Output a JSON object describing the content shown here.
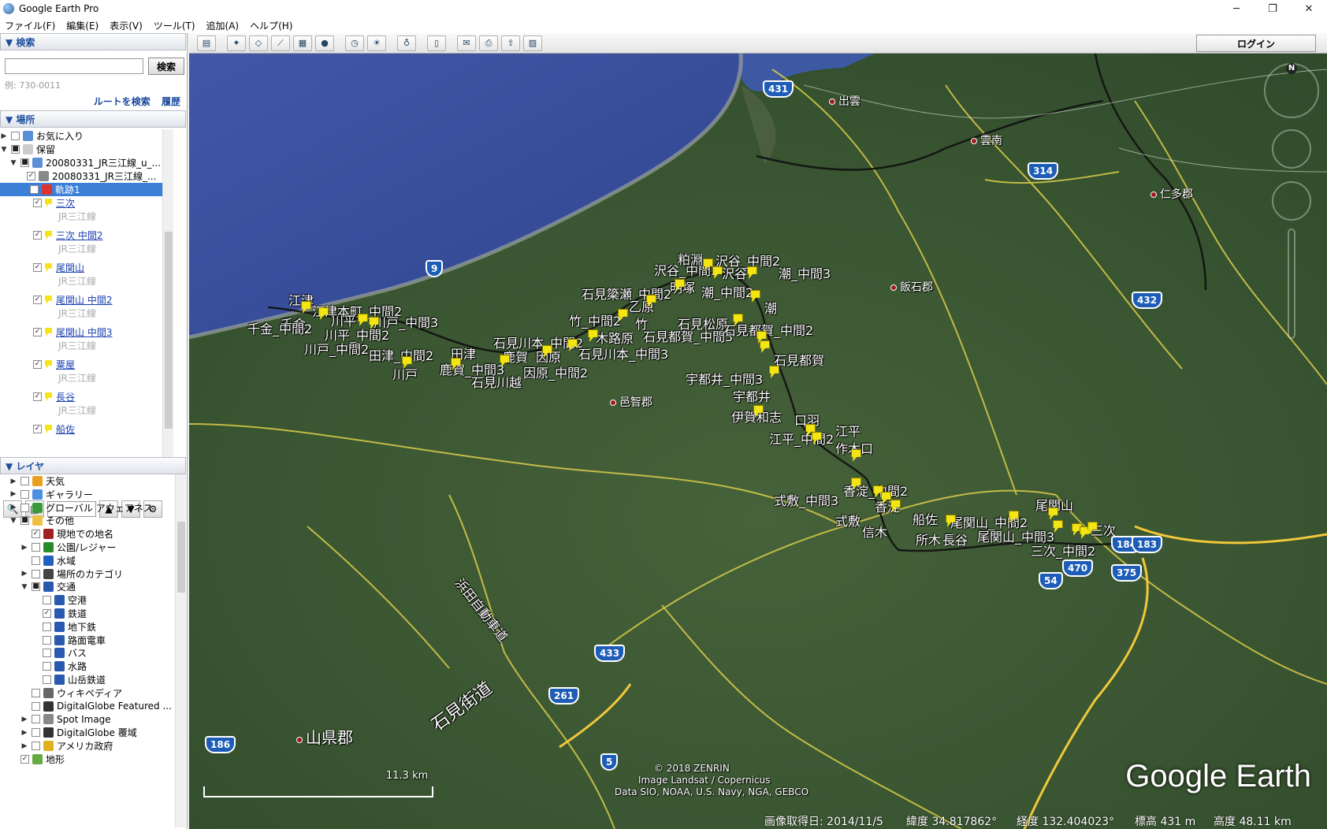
{
  "window": {
    "title": "Google Earth Pro",
    "minimize": "─",
    "maximize": "❐",
    "close": "✕"
  },
  "menu": [
    "ファイル(F)",
    "編集(E)",
    "表示(V)",
    "ツール(T)",
    "追加(A)",
    "ヘルプ(H)"
  ],
  "search": {
    "header": "▼ 検索",
    "button": "検索",
    "hint": "例: 730-0011",
    "route": "ルートを検索",
    "history": "履歴"
  },
  "places": {
    "header": "▼ 場所",
    "favorites": "お気に入り",
    "temporary": "保留",
    "kml1": "20080331_JR三江線_u_...",
    "kml2": "20080331_JR三江線_...",
    "track": "軌跡1",
    "sub": "JR三江線",
    "items": [
      "三次",
      "三次 中間2",
      "尾関山",
      "尾関山 中間2",
      "尾関山 中間3",
      "粟屋",
      "長谷",
      "船佐"
    ]
  },
  "layers": {
    "header": "▼ レイヤ",
    "items": [
      "天気",
      "ギャラリー",
      "グローバル アウェアネス",
      "その他",
      "現地での地名",
      "公園/レジャー",
      "水域",
      "場所のカテゴリ",
      "交通",
      "空港",
      "鉄道",
      "地下鉄",
      "路面電車",
      "バス",
      "水路",
      "山岳鉄道",
      "ウィキペディア",
      "DigitalGlobe Featured ...",
      "Spot Image",
      "DigitalGlobe 覆域",
      "アメリカ政府",
      "地形"
    ]
  },
  "toolbar": {
    "login": "ログイン"
  },
  "map": {
    "stations": [
      "江津",
      "江津本町_中間2",
      "千金",
      "千金_中間2",
      "川平",
      "川戸_中間3",
      "川平_中間2",
      "川戸_中間2",
      "田津_中間2",
      "田津",
      "川戸",
      "鹿賀_中間3",
      "石見川越",
      "石見川本_中間2",
      "鹿賀",
      "因原",
      "石見川本_中間3",
      "因原_中間2",
      "木路原",
      "竹_中間2",
      "竹",
      "乙原",
      "石見簗瀬_中間2",
      "明塚",
      "沢谷_中間3",
      "粕淵",
      "沢谷_中間2",
      "沢谷",
      "潮_中間3",
      "潮_中間2",
      "潮",
      "石見松原",
      "石見都賀_中間3",
      "石見都賀_中間2",
      "石見都賀",
      "宇都井_中間3",
      "宇都井",
      "伊賀和志",
      "口羽",
      "江平_中間2",
      "江平",
      "作木口",
      "香淀_中間2",
      "式敷_中間3",
      "香淀",
      "式敷",
      "信木",
      "船佐",
      "所木",
      "長谷",
      "尾関山_中間2",
      "尾関山",
      "尾関山_中間3",
      "三次",
      "三次_中間2"
    ],
    "cities": [
      "邑智郡",
      "飯石郡",
      "雲南",
      "出雲",
      "仁多郡",
      "山県郡"
    ],
    "roads": [
      "9",
      "186",
      "261",
      "433",
      "5",
      "54",
      "470",
      "184",
      "183",
      "375",
      "432",
      "314",
      "431"
    ],
    "highway": "浜田自動車道",
    "highway2": "石見街道",
    "copyright": [
      "© 2018 ZENRIN",
      "Image Landsat / Copernicus",
      "Data SIO, NOAA, U.S. Navy, NGA, GEBCO"
    ],
    "scale": "11.3 km",
    "logo": "Google Earth",
    "status": {
      "date": "画像取得日: 2014/11/5",
      "lat": "緯度 34.817862°",
      "lon": "経度 132.404023°",
      "elev": "標高 431 m",
      "alt": "高度 48.11 km"
    }
  }
}
